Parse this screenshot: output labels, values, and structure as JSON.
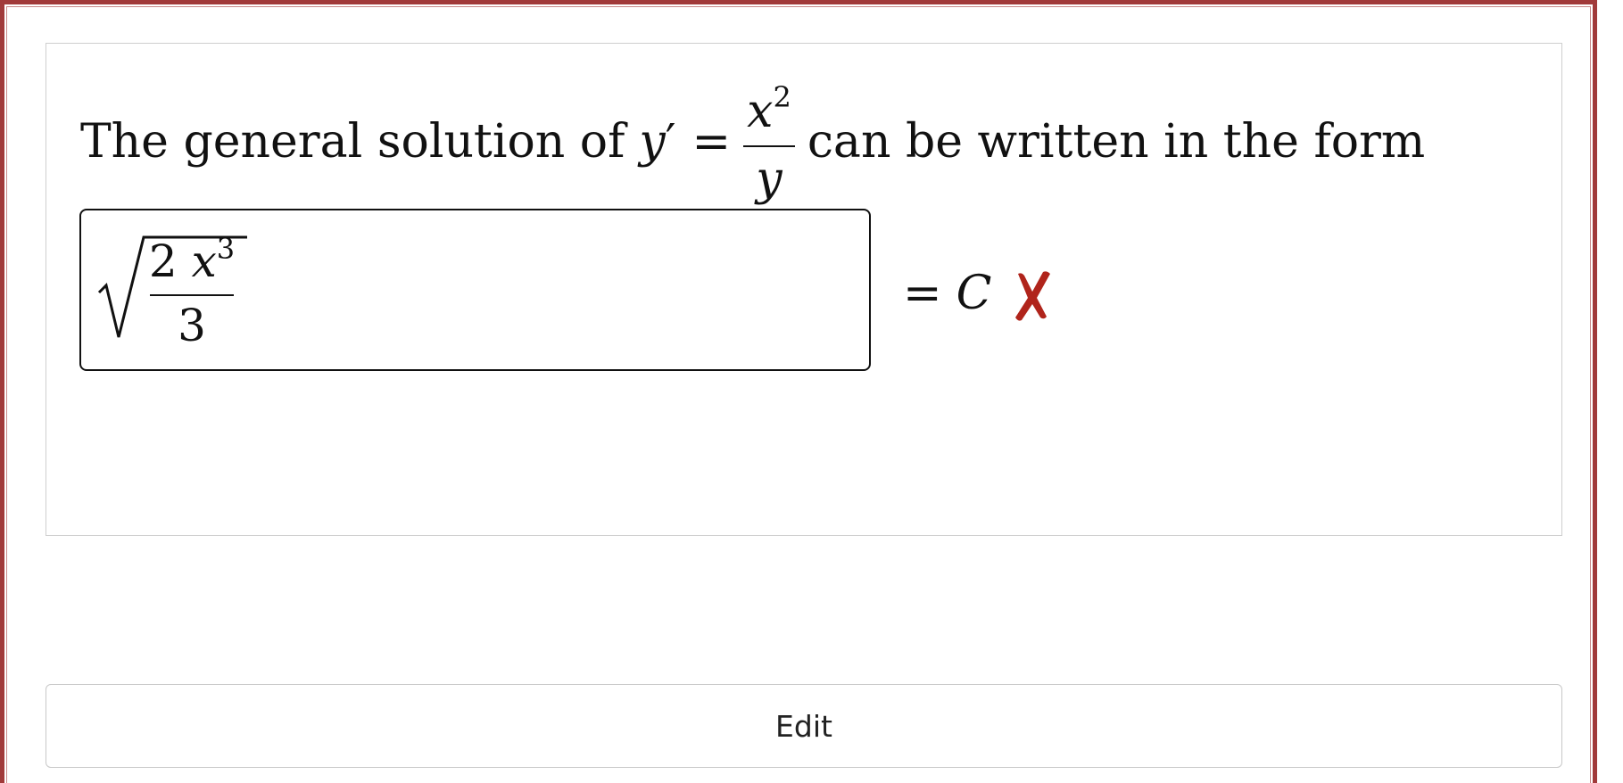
{
  "question": {
    "prompt_before": "The general solution of",
    "lhs_var": "y",
    "lhs_prime": "′",
    "equals": "=",
    "fraction_num_var": "x",
    "fraction_num_exp": "2",
    "fraction_den_var": "y",
    "prompt_after": "can be written in the form"
  },
  "answer": {
    "entered_num_coeff": "2",
    "entered_num_var": "x",
    "entered_num_exp": "3",
    "entered_den": "3",
    "rhs_equals": "=",
    "rhs_const": "C",
    "status": "incorrect",
    "status_color": "#b0241b"
  },
  "actions": {
    "edit_label": "Edit"
  },
  "colors": {
    "frame_border": "#a13a3a",
    "card_border": "#cfcfcf"
  }
}
